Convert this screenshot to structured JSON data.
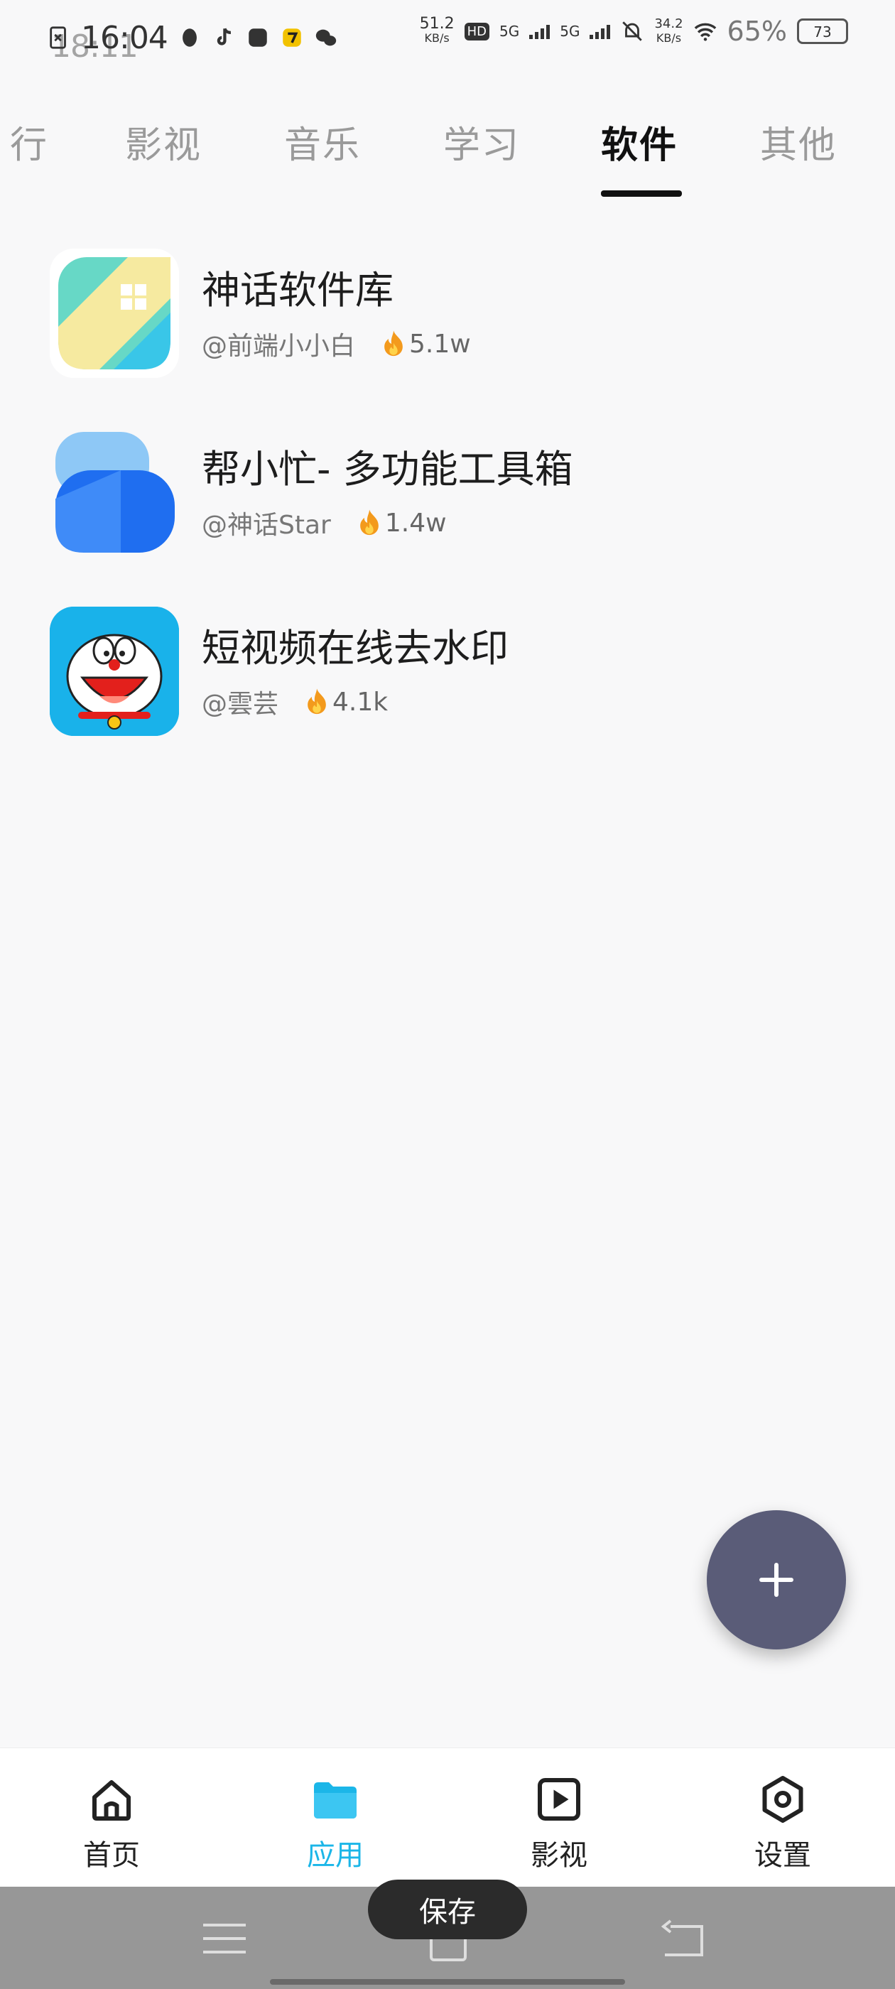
{
  "status_bar": {
    "time": "16:04",
    "time_ghost": "18:11",
    "net_speed_1": "51.2",
    "net_speed_1_unit": "KB/s",
    "net_speed_2": "34.2",
    "net_speed_2_unit": "KB/s",
    "battery": "73",
    "battery_pct_ghost": "65%",
    "hd_label": "HD",
    "sig_1": "5G",
    "sig_2": "5G"
  },
  "tabs": [
    {
      "label": "行",
      "active": false
    },
    {
      "label": "影视",
      "active": false
    },
    {
      "label": "音乐",
      "active": false
    },
    {
      "label": "学习",
      "active": false
    },
    {
      "label": "软件",
      "active": true
    },
    {
      "label": "其他",
      "active": false
    }
  ],
  "apps": [
    {
      "title": "神话软件库",
      "author": "@前端小小白",
      "heat": "5.1w"
    },
    {
      "title": "帮小忙- 多功能工具箱",
      "author": "@神话Star",
      "heat": "1.4w"
    },
    {
      "title": "短视频在线去水印",
      "author": "@雲芸",
      "heat": "4.1k"
    }
  ],
  "fab": {
    "icon": "plus-icon"
  },
  "bottom_nav": [
    {
      "label": "首页",
      "icon": "home-icon",
      "active": false
    },
    {
      "label": "应用",
      "icon": "folder-icon",
      "active": true
    },
    {
      "label": "影视",
      "icon": "play-icon",
      "active": false
    },
    {
      "label": "设置",
      "icon": "settings-icon",
      "active": false
    }
  ],
  "system": {
    "save_label": "保存"
  },
  "colors": {
    "accent": "#1bb6e8",
    "fab": "#5a5c78",
    "active_tab": "#111111",
    "inactive_tab": "#9a9a9a"
  }
}
